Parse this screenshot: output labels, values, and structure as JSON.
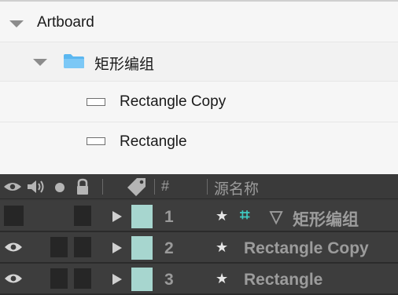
{
  "tree": {
    "artboard_label": "Artboard",
    "group_label": "矩形编组",
    "items": [
      {
        "label": "Rectangle Copy"
      },
      {
        "label": "Rectangle"
      }
    ]
  },
  "timeline": {
    "header": {
      "hash_label": "#",
      "source_name_label": "源名称"
    },
    "layers": [
      {
        "number": "1",
        "name": "矩形编组",
        "is_group": true,
        "visible": false
      },
      {
        "number": "2",
        "name": "Rectangle Copy",
        "is_group": false,
        "visible": true
      },
      {
        "number": "3",
        "name": "Rectangle",
        "is_group": false,
        "visible": true
      }
    ],
    "label_color": "#a7d6cf",
    "accent_color": "#3fc9c2"
  }
}
